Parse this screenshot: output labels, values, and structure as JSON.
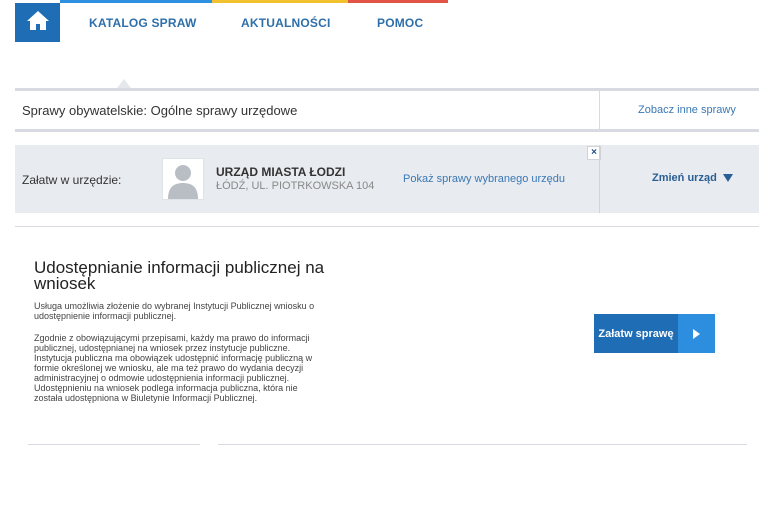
{
  "colors": {
    "strip_blue": "#2f8fe0",
    "strip_yellow": "#f2c12e",
    "strip_red": "#e05545",
    "brand_blue": "#1e6db5",
    "link_blue": "#3a78b5"
  },
  "nav": {
    "home_icon": "home-icon",
    "tabs": [
      {
        "label": "KATALOG SPRAW"
      },
      {
        "label": "AKTUALNOŚCI"
      },
      {
        "label": "POMOC"
      }
    ]
  },
  "category": {
    "title": "Sprawy obywatelskie: Ogólne sprawy urzędowe",
    "other_link": "Zobacz inne sprawy"
  },
  "office": {
    "label": "Załatw w urzędzie:",
    "avatar_icon": "person-silhouette-icon",
    "name": "URZĄD MIASTA ŁODZI",
    "address": "ŁÓDŹ, UL. PIOTRKOWSKA 104",
    "show_services_link": "Pokaż sprawy wybranego urzędu",
    "close_symbol": "×",
    "change_label": "Zmień urząd"
  },
  "service": {
    "title": "Udostępnianie informacji publicznej na wniosek",
    "intro_lines": [
      "Usługa umożliwia złożenie do wybranej Instytucji Publicznej wniosku o",
      "udostępnienie informacji publicznej."
    ],
    "body_lines": [
      "Zgodnie z obowiązującymi przepisami, każdy ma prawo do informacji",
      "publicznej, udostępnianej na wniosek przez instytucje publiczne.",
      "Instytucja publiczna ma obowiązek udostępnić informację publiczną w",
      "formie określonej we wniosku, ale ma też prawo do wydania decyzji",
      "administracyjnej o odmowie udostępnienia informacji publicznej.",
      "Udostępnieniu na wniosek podlega informacja publiczna, która nie",
      "została udostępniona w Biuletynie Informacji Publicznej."
    ],
    "action_label": "Załatw sprawę"
  }
}
